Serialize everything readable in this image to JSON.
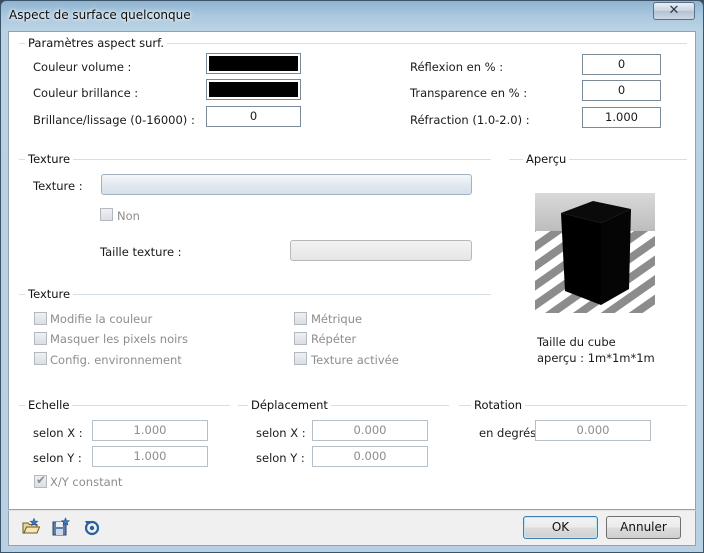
{
  "window": {
    "title": "Aspect de surface quelconque",
    "close_glyph": "✕"
  },
  "surface": {
    "title": "Paramètres aspect surf.",
    "volume_color_label": "Couleur volume :",
    "shine_color_label": "Couleur brillance :",
    "smoothness_label": "Brillance/lissage (0-16000) :",
    "smoothness_value": "0",
    "reflection_label": "Réflexion en % :",
    "reflection_value": "0",
    "transparency_label": "Transparence en % :",
    "transparency_value": "0",
    "refraction_label": "Réfraction (1.0-2.0) :",
    "refraction_value": "1.000",
    "volume_color": "#000000",
    "shine_color": "#000000"
  },
  "texture1": {
    "title": "Texture",
    "texture_label": "Texture :",
    "none_label": "Non",
    "size_label": "Taille texture :"
  },
  "preview": {
    "title": "Aperçu",
    "caption_line1": "Taille du cube",
    "caption_line2": "aperçu : 1m*1m*1m"
  },
  "texture2": {
    "title": "Texture",
    "options_left": [
      "Modifie la couleur",
      "Masquer les pixels noirs",
      "Config. environnement"
    ],
    "options_right": [
      "Métrique",
      "Répéter",
      "Texture activée"
    ]
  },
  "scale": {
    "title": "Echelle",
    "x_label": "selon X :",
    "x_value": "1.000",
    "y_label": "selon Y :",
    "y_value": "1.000",
    "constant_label": "X/Y constant",
    "constant_checked": true
  },
  "offset": {
    "title": "Déplacement",
    "x_label": "selon X :",
    "x_value": "0.000",
    "y_label": "selon Y :",
    "y_value": "0.000"
  },
  "rotation": {
    "title": "Rotation",
    "label": "en degrés",
    "value": "0.000"
  },
  "footer": {
    "ok_label": "OK",
    "cancel_label": "Annuler",
    "icons": [
      "open-favorite-icon",
      "save-favorite-icon",
      "reset-icon"
    ]
  }
}
